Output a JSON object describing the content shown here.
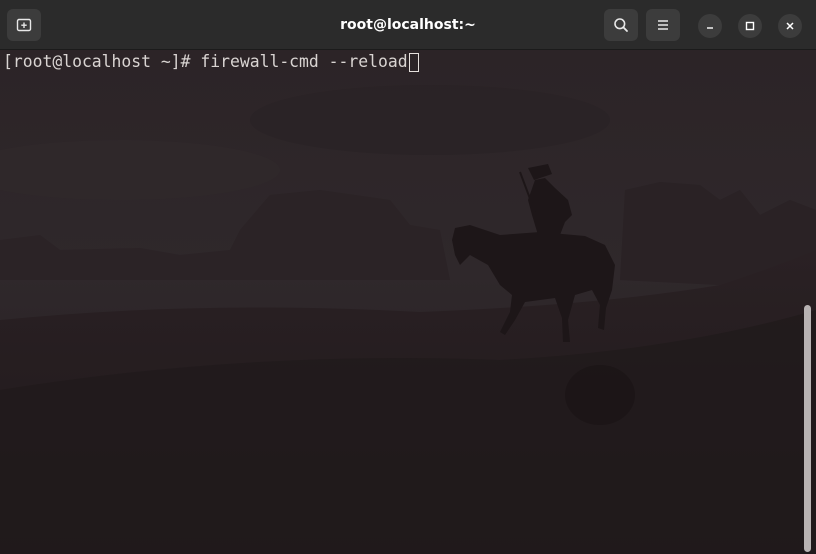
{
  "window": {
    "title": "root@localhost:~"
  },
  "icons": {
    "new_tab": "new-tab-icon",
    "search": "search-icon",
    "menu": "hamburger-menu-icon",
    "minimize": "minimize-icon",
    "maximize": "maximize-icon",
    "close": "close-icon"
  },
  "terminal": {
    "prompt": "[root@localhost ~]# ",
    "command": "firewall-cmd --reload"
  },
  "colors": {
    "titlebar": "#2b2b2b",
    "button": "#3c3c3c",
    "terminal_text": "#d9d4d2",
    "scrollbar": "#b8b3b3"
  }
}
